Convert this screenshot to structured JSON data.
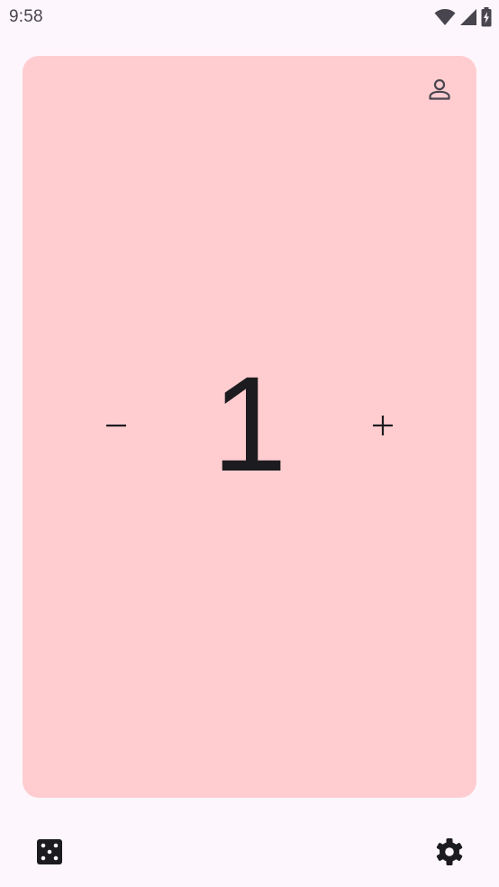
{
  "status_bar": {
    "time": "9:58",
    "icons": [
      "wifi-icon",
      "signal-icon",
      "battery-charging-icon"
    ]
  },
  "counter": {
    "value": "1",
    "card_color": "#ffcdd0",
    "decrement_icon": "minus-icon",
    "increment_icon": "plus-icon",
    "profile_icon": "person-icon"
  },
  "bottom_bar": {
    "left_icon": "dice-icon",
    "right_icon": "gear-icon"
  },
  "colors": {
    "background": "#fdf7fd",
    "text": "#1c1b1f",
    "muted": "#49454f"
  }
}
